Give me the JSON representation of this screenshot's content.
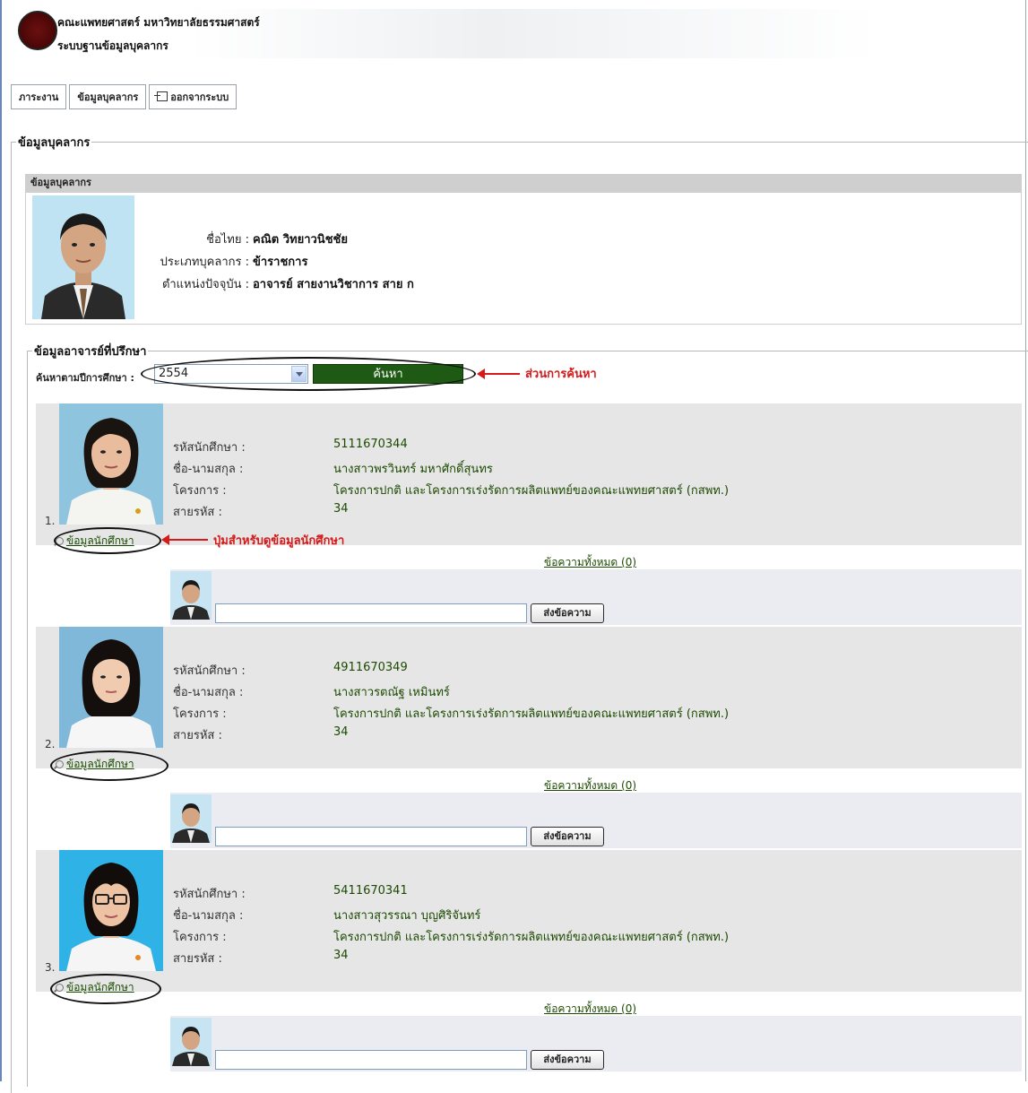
{
  "header": {
    "org_name": "คณะแพทยศาสตร์ มหาวิทยาลัยธรรมศาสตร์",
    "system_name": "ระบบฐานข้อมูลบุคลากร"
  },
  "menu": {
    "items": [
      {
        "label": "ภาระงาน"
      },
      {
        "label": "ข้อมูลบุคลากร"
      },
      {
        "label": "ออกจากระบบ",
        "icon": "logout-icon"
      }
    ]
  },
  "staff_section": {
    "legend": "ข้อมูลบุคลากร",
    "panel_title": "ข้อมูลบุคลากร",
    "rows": [
      {
        "label": "ชื่อไทย :",
        "value": "คณิต วิทยาวนิชชัย"
      },
      {
        "label": "ประเภทบุคลากร :",
        "value": "ข้าราชการ"
      },
      {
        "label": "ตำแหน่งปัจจุบัน :",
        "value": "อาจารย์ สายงานวิชาการ สาย ก"
      }
    ]
  },
  "advisor_section": {
    "legend": "ข้อมูลอาจารย์ที่ปรึกษา",
    "search_label": "ค้นหาตามปีการศึกษา :",
    "year_selected": "2554",
    "search_button": "ค้นหา",
    "annotation_search": "ส่วนการค้นหา",
    "annotation_button": "ปุ่มสำหรับดูข้อมูลนักศึกษา"
  },
  "student_fields": {
    "id": "รหัสนักศึกษา :",
    "name": "ชื่อ-นามสกุล :",
    "program": "โครงการ :",
    "line": "สายรหัส :"
  },
  "students": [
    {
      "num": "1.",
      "id": "5111670344",
      "name": "นางสาวพรวินทร์ มหาศักดิ์สุนทร",
      "program": "โครงการปกติ และโครงการเร่งรัดการผลิตแพทย์ของคณะแพทยศาสตร์ (กสพท.)",
      "line": "34",
      "link": "ข้อมูลนักศึกษา",
      "messages": "ข้อความทั้งหมด (0)",
      "send": "ส่งข้อความ"
    },
    {
      "num": "2.",
      "id": "4911670349",
      "name": "นางสาวรตณัฐ เหมินทร์",
      "program": "โครงการปกติ และโครงการเร่งรัดการผลิตแพทย์ของคณะแพทยศาสตร์ (กสพท.)",
      "line": "34",
      "link": "ข้อมูลนักศึกษา",
      "messages": "ข้อความทั้งหมด (0)",
      "send": "ส่งข้อความ"
    },
    {
      "num": "3.",
      "id": "5411670341",
      "name": "นางสาวสุวรรณา บุญศิริจันทร์",
      "program": "โครงการปกติ และโครงการเร่งรัดการผลิตแพทย์ของคณะแพทยศาสตร์ (กสพท.)",
      "line": "34",
      "link": "ข้อมูลนักศึกษา",
      "messages": "ข้อความทั้งหมด (0)",
      "send": "ส่งข้อความ"
    }
  ]
}
